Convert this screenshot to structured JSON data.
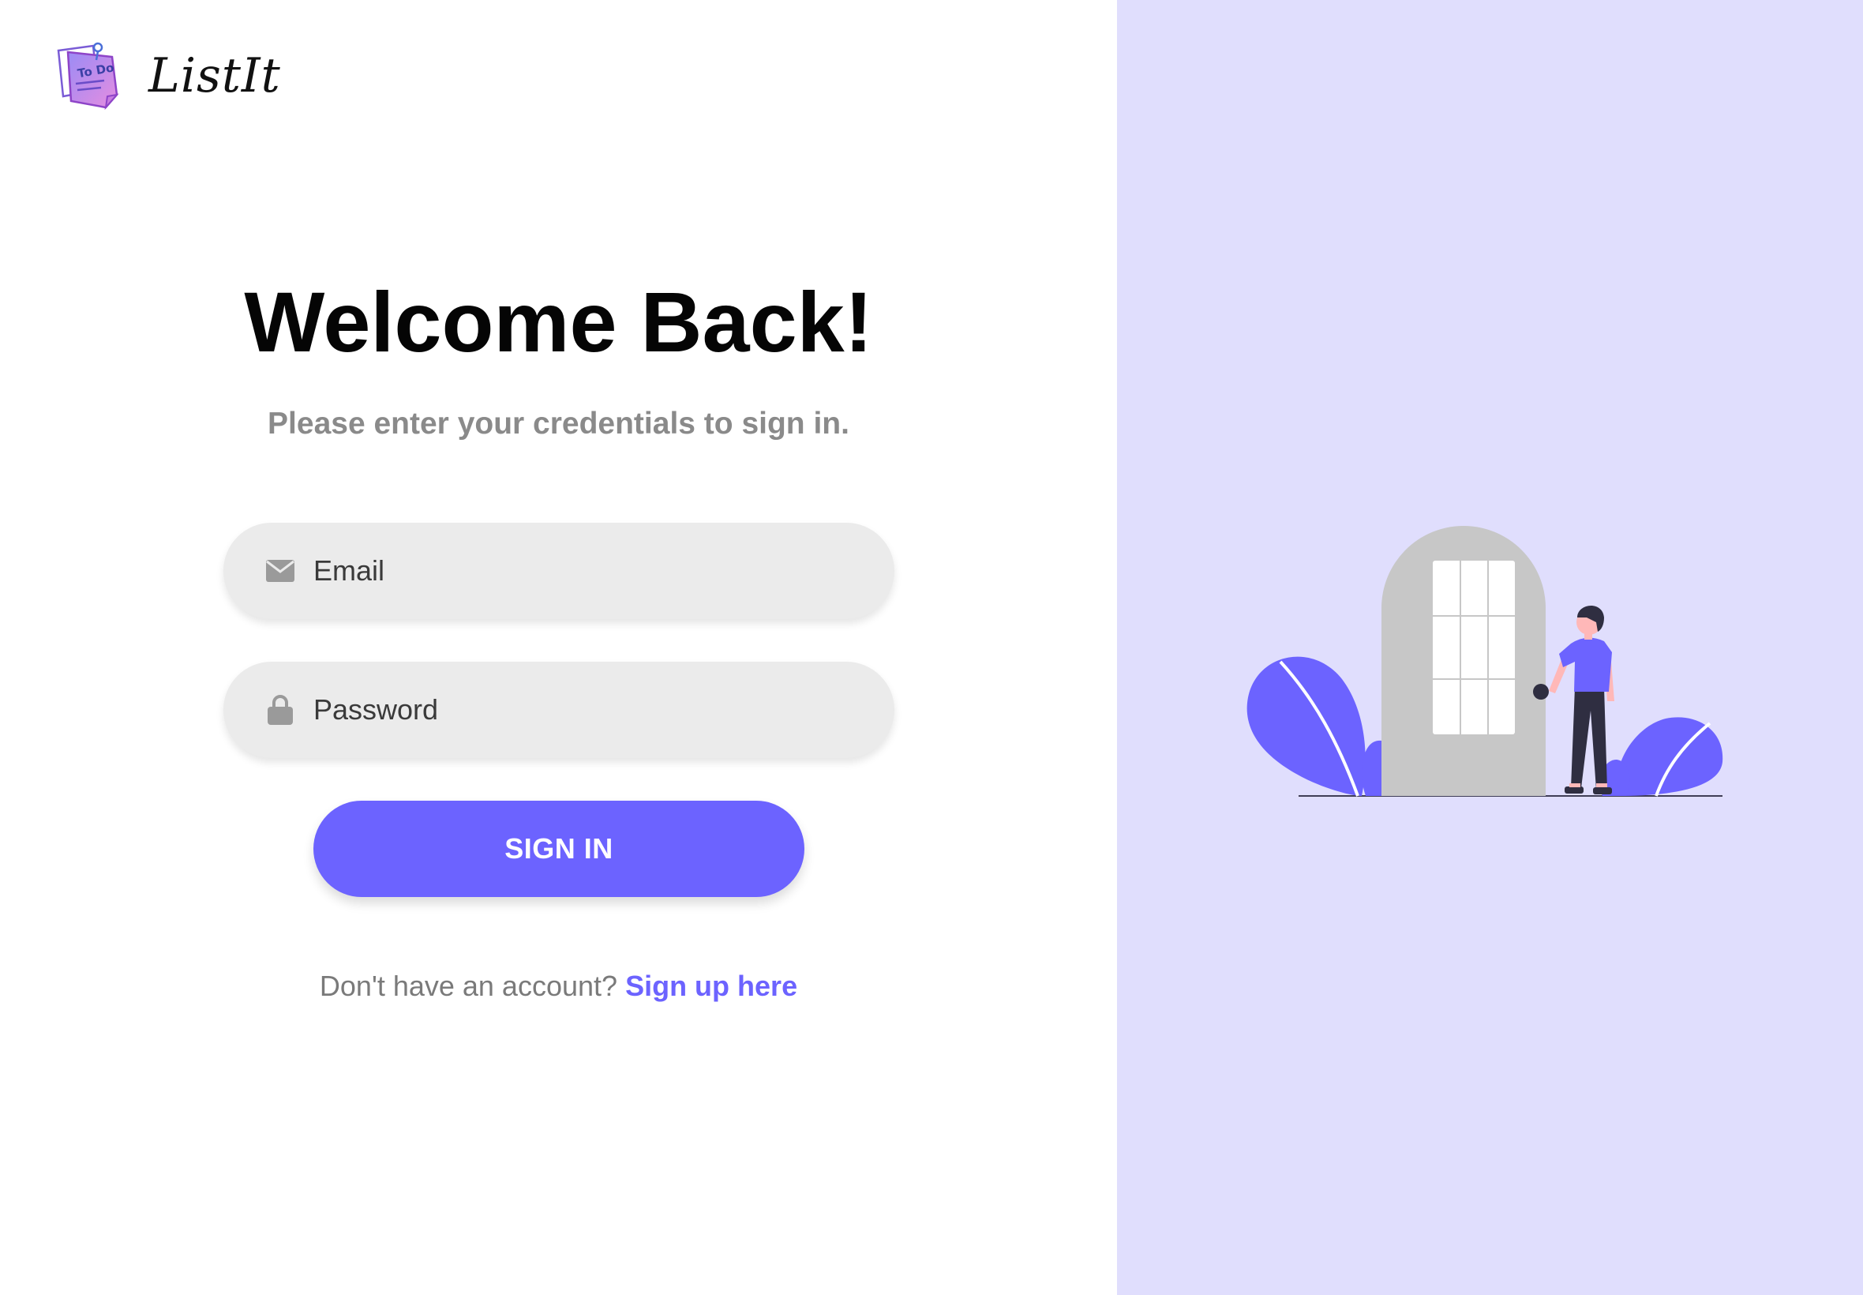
{
  "brand": {
    "name": "ListIt",
    "logo_text": "To Do"
  },
  "login": {
    "title": "Welcome Back!",
    "subtitle": "Please enter your credentials to sign in.",
    "email_placeholder": "Email",
    "password_placeholder": "Password",
    "signin_label": "SIGN IN",
    "signup_prompt": "Don't have an account?",
    "signup_link": "Sign up here"
  },
  "colors": {
    "accent": "#6c63ff",
    "right_pane_bg": "#e0defd",
    "field_bg": "#ebebeb"
  },
  "icons": {
    "email": "envelope-icon",
    "password": "lock-icon"
  }
}
